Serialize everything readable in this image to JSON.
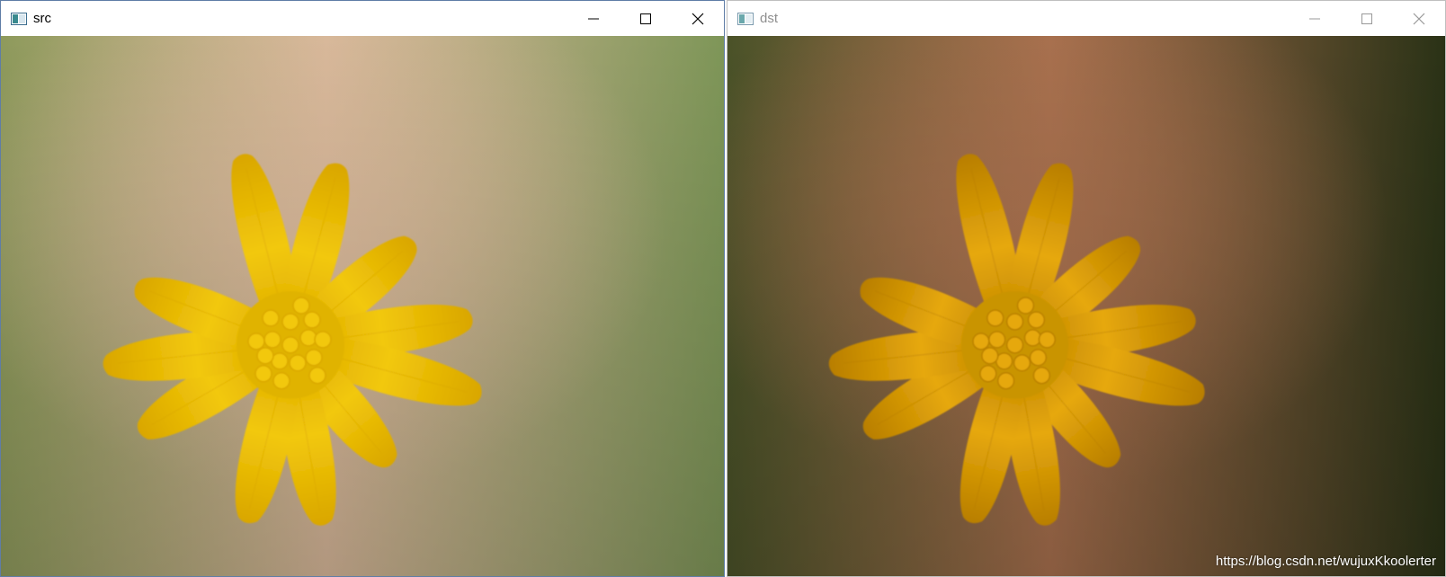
{
  "windows": [
    {
      "title": "src",
      "buttons": {
        "minimize": "minimize-icon",
        "maximize": "maximize-icon",
        "close": "close-icon"
      },
      "colors": {
        "bg_center": "#d8b89a",
        "bg_left": "#8e9a5c",
        "bg_right": "#7e9658",
        "petal": "#f2c80a",
        "petal_edge": "#d9a600",
        "disc": "#e0b300"
      }
    },
    {
      "title": "dst",
      "buttons": {
        "minimize": "minimize-icon",
        "maximize": "maximize-icon",
        "close": "close-icon"
      },
      "colors": {
        "bg_center": "#a8704e",
        "bg_left": "#4a5228",
        "bg_right": "#2a3216",
        "petal": "#e6a80a",
        "petal_edge": "#b87e00",
        "disc": "#c99400"
      }
    }
  ],
  "watermark": "https://blog.csdn.net/wujuxKkoolerter"
}
